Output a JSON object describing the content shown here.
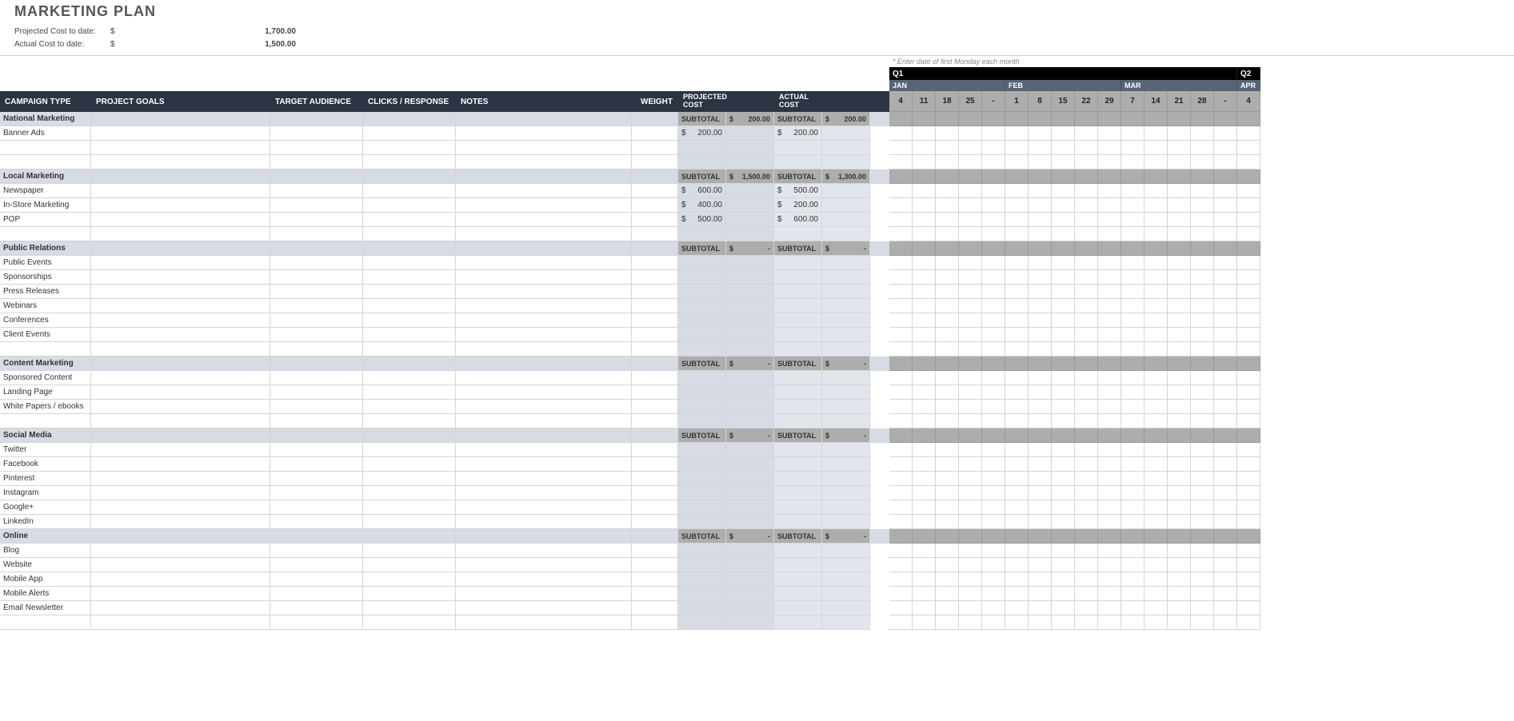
{
  "title": "MARKETING PLAN",
  "summary": {
    "projected_label": "Projected Cost to date:",
    "projected_cur": "$",
    "projected_val": "1,700.00",
    "actual_label": "Actual Cost to date:",
    "actual_cur": "$",
    "actual_val": "1,500.00"
  },
  "cal_hint": "* Enter date of first Monday each month",
  "quarters": [
    {
      "label": "Q1",
      "span": 15
    },
    {
      "label": "Q2",
      "span": 1
    }
  ],
  "months": [
    {
      "label": "JAN",
      "span": 5
    },
    {
      "label": "FEB",
      "span": 5
    },
    {
      "label": "MAR",
      "span": 5
    },
    {
      "label": "APR",
      "span": 1
    }
  ],
  "days": [
    "4",
    "11",
    "18",
    "25",
    "-",
    "1",
    "8",
    "15",
    "22",
    "29",
    "7",
    "14",
    "21",
    "28",
    "-",
    "4"
  ],
  "headers": {
    "campaign": "CAMPAIGN TYPE",
    "goals": "PROJECT GOALS",
    "audience": "TARGET AUDIENCE",
    "clicks": "CLICKS / RESPONSE",
    "notes": "NOTES",
    "weight": "WEIGHT",
    "pcost": "PROJECTED COST",
    "acost": "ACTUAL COST"
  },
  "sections": [
    {
      "name": "National Marketing",
      "sub_pc": "SUBTOTAL",
      "sub_pcv": "$   200.00",
      "sub_ac": "SUBTOTAL",
      "sub_acv": "$   200.00",
      "rows": [
        {
          "label": "Banner Ads",
          "pc": "$   200.00",
          "ac": "$   200.00"
        },
        {
          "label": ""
        },
        {
          "label": ""
        }
      ]
    },
    {
      "name": "Local Marketing",
      "sub_pc": "SUBTOTAL",
      "sub_pcv": "$ 1,500.00",
      "sub_ac": "SUBTOTAL",
      "sub_acv": "$ 1,300.00",
      "rows": [
        {
          "label": "Newspaper",
          "pc": "$   600.00",
          "ac": "$   500.00"
        },
        {
          "label": "In-Store Marketing",
          "pc": "$   400.00",
          "ac": "$   200.00"
        },
        {
          "label": "POP",
          "pc": "$   500.00",
          "ac": "$   600.00"
        },
        {
          "label": ""
        }
      ]
    },
    {
      "name": "Public Relations",
      "sub_pc": "SUBTOTAL",
      "sub_pcv": "$        -",
      "sub_ac": "SUBTOTAL",
      "sub_acv": "$        -",
      "rows": [
        {
          "label": "Public Events"
        },
        {
          "label": "Sponsorships"
        },
        {
          "label": "Press Releases"
        },
        {
          "label": "Webinars"
        },
        {
          "label": "Conferences"
        },
        {
          "label": "Client Events"
        },
        {
          "label": ""
        }
      ]
    },
    {
      "name": "Content Marketing",
      "sub_pc": "SUBTOTAL",
      "sub_pcv": "$        -",
      "sub_ac": "SUBTOTAL",
      "sub_acv": "$        -",
      "rows": [
        {
          "label": "Sponsored Content"
        },
        {
          "label": "Landing Page"
        },
        {
          "label": "White Papers / ebooks"
        },
        {
          "label": ""
        }
      ]
    },
    {
      "name": "Social Media",
      "sub_pc": "SUBTOTAL",
      "sub_pcv": "$        -",
      "sub_ac": "SUBTOTAL",
      "sub_acv": "$        -",
      "rows": [
        {
          "label": "Twitter"
        },
        {
          "label": "Facebook"
        },
        {
          "label": "Pinterest"
        },
        {
          "label": "Instagram"
        },
        {
          "label": "Google+"
        },
        {
          "label": "LinkedIn"
        }
      ]
    },
    {
      "name": "Online",
      "sub_pc": "SUBTOTAL",
      "sub_pcv": "$        -",
      "sub_ac": "SUBTOTAL",
      "sub_acv": "$        -",
      "rows": [
        {
          "label": "Blog"
        },
        {
          "label": "Website"
        },
        {
          "label": "Mobile App"
        },
        {
          "label": "Mobile Alerts"
        },
        {
          "label": "Email Newsletter"
        },
        {
          "label": ""
        }
      ]
    }
  ]
}
